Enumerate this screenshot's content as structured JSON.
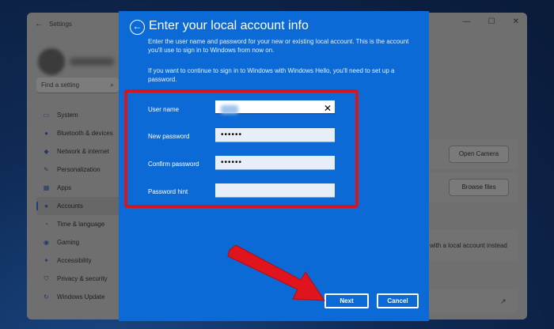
{
  "settings_window": {
    "back_icon": "back-arrow-icon",
    "title": "Settings",
    "controls": [
      "minimize-icon",
      "maximize-icon",
      "close-icon"
    ],
    "search_placeholder": "Find a setting",
    "nav_items": [
      {
        "icon": "system-icon",
        "label": "System"
      },
      {
        "icon": "bluetooth-icon",
        "label": "Bluetooth & devices"
      },
      {
        "icon": "network-icon",
        "label": "Network & internet"
      },
      {
        "icon": "personalization-icon",
        "label": "Personalization"
      },
      {
        "icon": "apps-icon",
        "label": "Apps"
      },
      {
        "icon": "accounts-icon",
        "label": "Accounts",
        "active": true
      },
      {
        "icon": "time-language-icon",
        "label": "Time & language"
      },
      {
        "icon": "gaming-icon",
        "label": "Gaming"
      },
      {
        "icon": "accessibility-icon",
        "label": "Accessibility"
      },
      {
        "icon": "privacy-icon",
        "label": "Privacy & security"
      },
      {
        "icon": "windows-update-icon",
        "label": "Windows Update"
      }
    ],
    "open_camera_label": "Open Camera",
    "browse_files_label": "Browse files",
    "local_account_text": "with a local account instead"
  },
  "dialog": {
    "title": "Enter your local account info",
    "description": "Enter the user name and password for your new or existing local account. This is the account you'll use to sign in to Windows from now on.",
    "hello_note": "If you want to continue to sign in to Windows with Windows Hello, you'll need to set up a password.",
    "fields": {
      "username_label": "User name",
      "new_password_label": "New password",
      "new_password_value": "••••••",
      "confirm_password_label": "Confirm password",
      "confirm_password_value": "••••••",
      "password_hint_label": "Password hint",
      "password_hint_value": ""
    },
    "next_label": "Next",
    "cancel_label": "Cancel"
  },
  "colors": {
    "dialog_bg": "#0b6ad6",
    "highlight_border": "#d6161e",
    "annotation_arrow": "#e0141c"
  }
}
